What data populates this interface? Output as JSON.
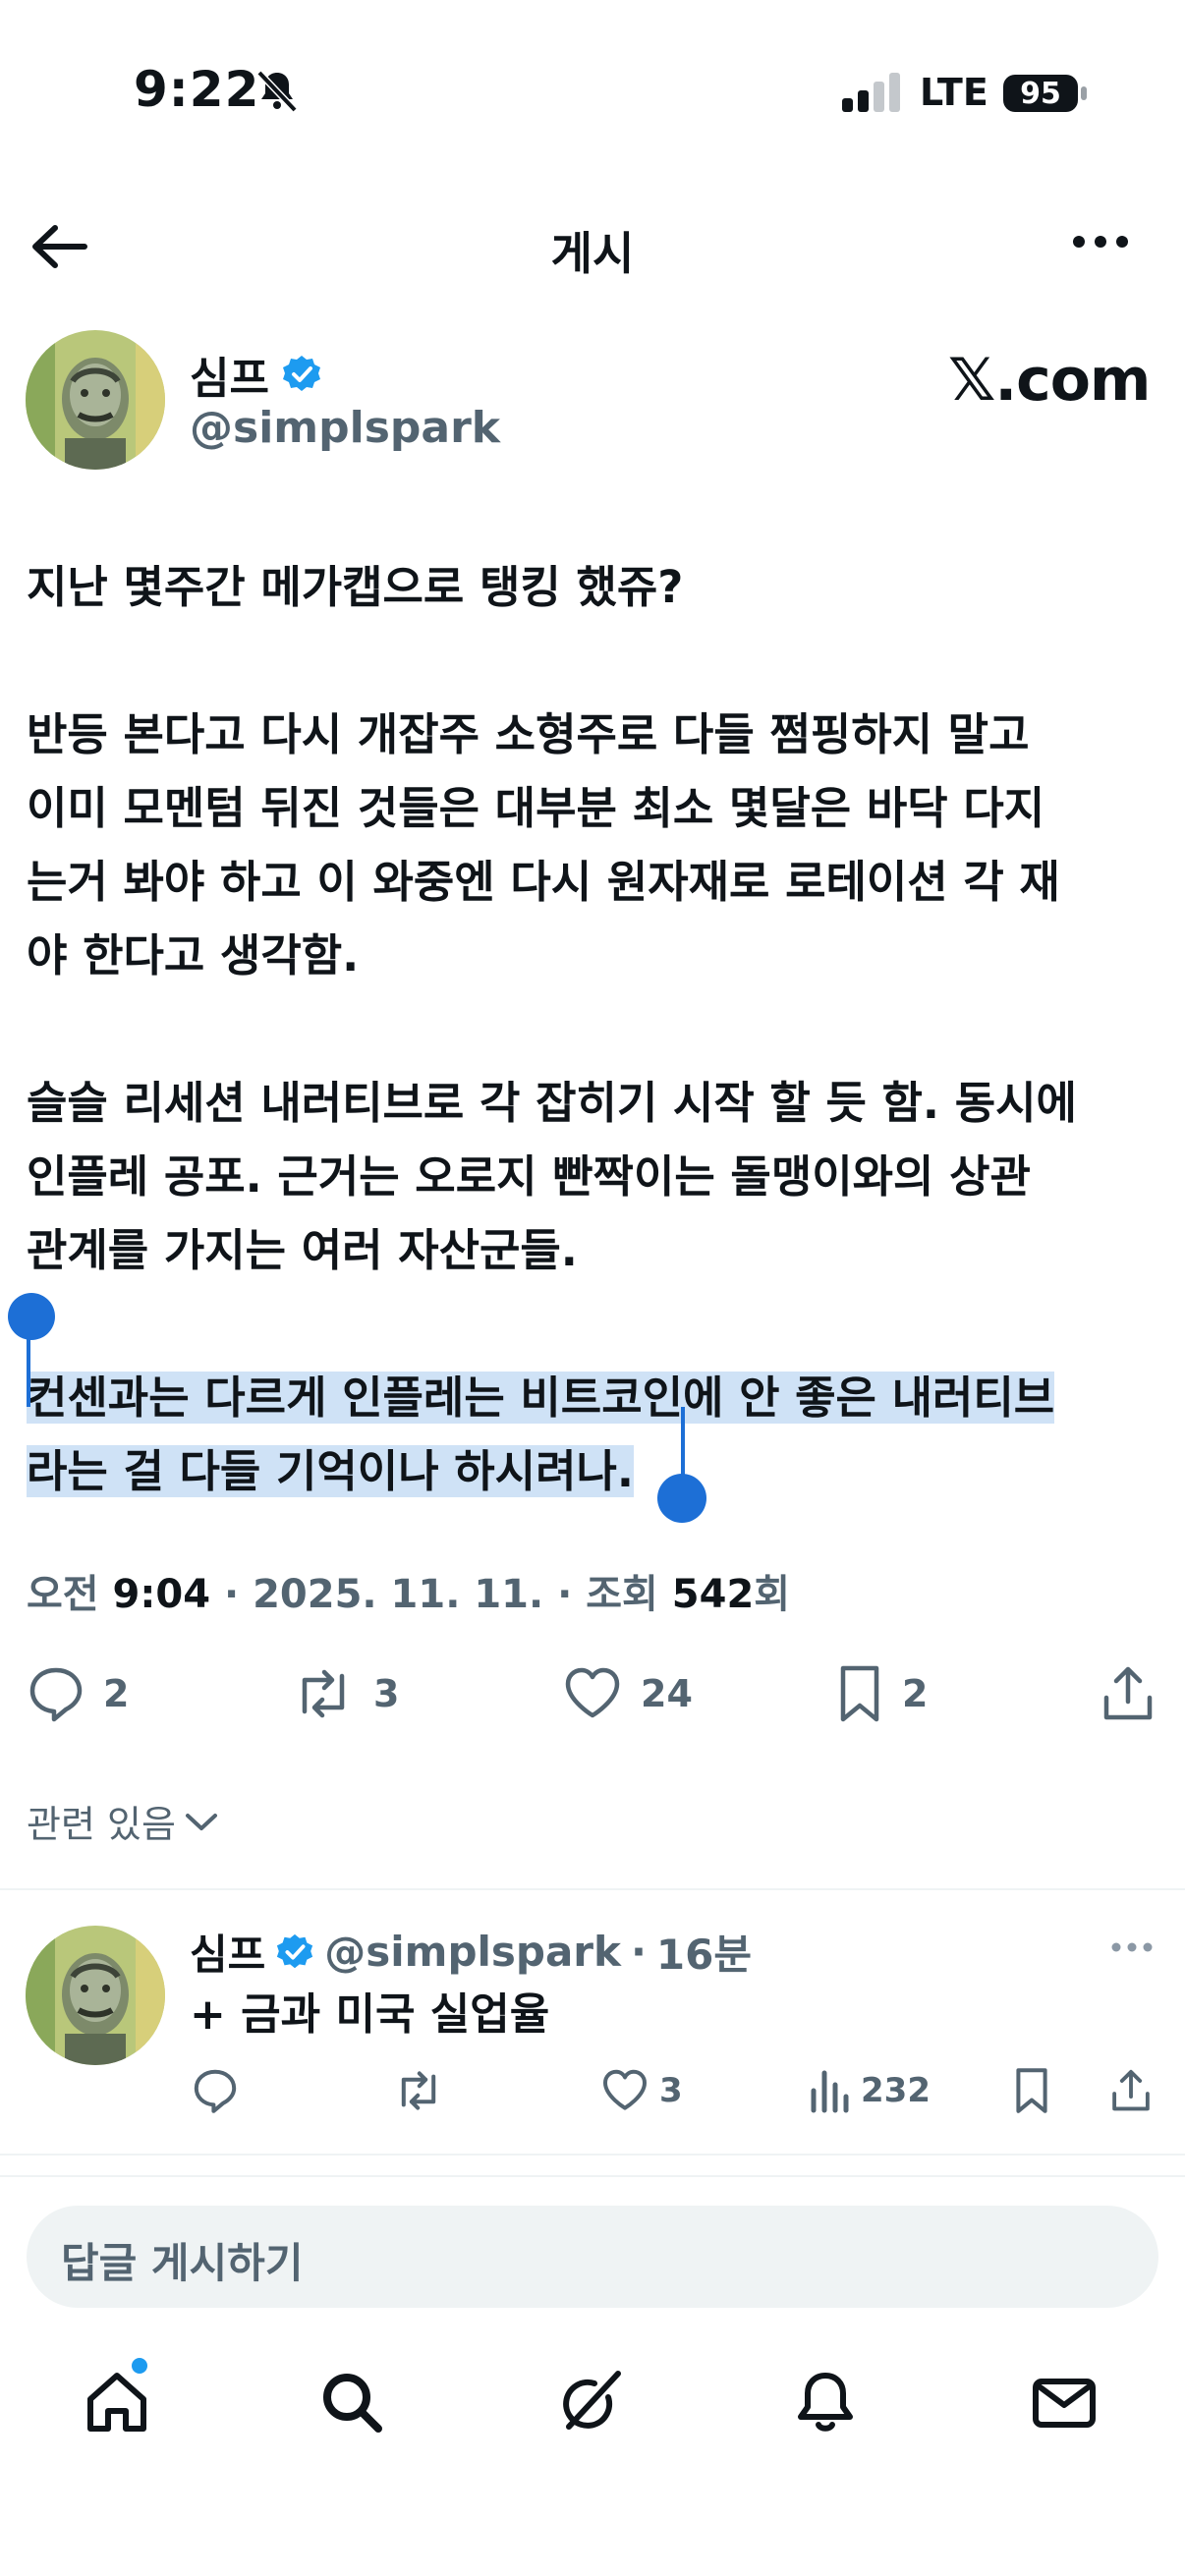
{
  "status_bar": {
    "time": "9:22",
    "network": "LTE",
    "battery": "95"
  },
  "header": {
    "title": "게시"
  },
  "post": {
    "author_name": "심프",
    "author_handle": "@simplspark",
    "brand": "𝕏.com",
    "paragraphs": [
      "지난 몇주간 메가캡으로 탱킹 했쥬?",
      "반등 본다고 다시 개잡주 소형주로 다들 쩜핑하지 말고\n이미 모멘텀 뒤진 것들은 대부분 최소 몇달은 바닥 다지\n는거 봐야 하고 이 와중엔 다시 원자재로 로테이션 각 재\n야 한다고 생각함.",
      "슬슬 리세션 내러티브로 각 잡히기 시작 할 듯 함. 동시에\n인플레 공포. 근거는 오로지 빤짝이는 돌맹이와의 상관\n관계를 가지는 여러 자산군들.",
      "컨센과는 다르게 인플레는 비트코인에 안 좋은 내러티브\n라는 걸 다들 기억이나 하시려나."
    ],
    "meta": {
      "ampm": "오전",
      "time": "9:04",
      "sep1": " · ",
      "date": "2025. 11. 11.",
      "sep2": " · ",
      "views_label": "조회",
      "views_count": "542",
      "views_suffix": "회"
    },
    "actions": {
      "replies": "2",
      "reposts": "3",
      "likes": "24",
      "bookmarks": "2"
    },
    "related_label": "관련 있음"
  },
  "reply": {
    "author_name": "심프",
    "author_handle": "@simplspark",
    "separator": "·",
    "time": "16분",
    "text": "+ 금과 미국 실업율",
    "likes": "3",
    "views": "232"
  },
  "composer": {
    "placeholder": "답글 게시하기"
  },
  "tabbar": {
    "items": [
      "home-icon",
      "search-icon",
      "grok-icon",
      "notifications-icon",
      "messages-icon"
    ]
  },
  "colors": {
    "accent": "#1d9bf0",
    "selection": "#cfe2f6",
    "muted": "#536471",
    "handle": "#1d6fd6"
  }
}
